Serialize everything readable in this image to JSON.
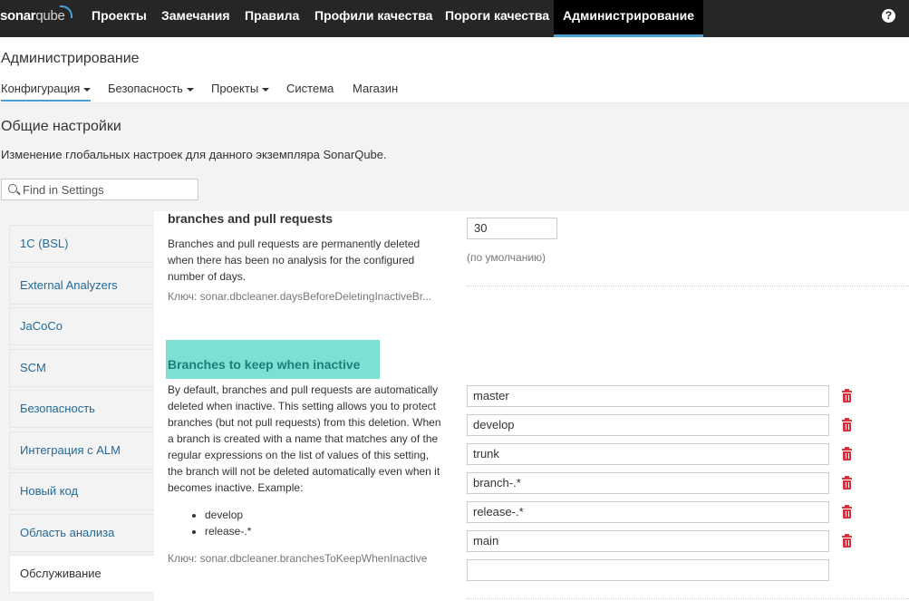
{
  "topnav": {
    "logo_bold": "sonar",
    "logo_light": "qube",
    "links": [
      "Проекты",
      "Замечания",
      "Правила",
      "Профили качества",
      "Пороги качества",
      "Администрирование"
    ],
    "help_glyph": "?"
  },
  "page": {
    "title": "Администрирование",
    "tabs": [
      "Конфигурация",
      "Безопасность",
      "Проекты",
      "Система",
      "Магазин"
    ]
  },
  "settings": {
    "title": "Общие настройки",
    "description": "Изменение глобальных настроек для данного экземпляра SonarQube.",
    "search_placeholder": "Find in Settings"
  },
  "sidebar": {
    "items": [
      "1C (BSL)",
      "External Analyzers",
      "JaCoCo",
      "SCM",
      "Безопасность",
      "Интеграция с ALM",
      "Новый код",
      "Область анализа",
      "Обслуживание"
    ],
    "active_index": 8
  },
  "props": {
    "branches_delete": {
      "title": "branches and pull requests",
      "desc": "Branches and pull requests are permanently deleted when there has been no analysis for the configured number of days.",
      "key": "Ключ: sonar.dbcleaner.daysBeforeDeletingInactiveBr...",
      "value": "30",
      "hint": "(по умолчанию)"
    },
    "branches_keep": {
      "title": "Branches to keep when inactive",
      "desc": "By default, branches and pull requests are automatically deleted when inactive. This setting allows you to protect branches (but not pull requests) from this deletion. When a branch is created with a name that matches any of the regular expressions on the list of values of this setting, the branch will not be deleted automatically even when it becomes inactive. Example:",
      "examples": [
        "develop",
        "release-.*"
      ],
      "key": "Ключ: sonar.dbcleaner.branchesToKeepWhenInactive",
      "values": [
        "master",
        "develop",
        "trunk",
        "branch-.*",
        "release-.*",
        "main",
        ""
      ]
    }
  },
  "colors": {
    "nav_bg": "#262626",
    "accent": "#4b9fd5",
    "highlight": "#7ee0d2",
    "delete": "#d4333f",
    "link": "#236a97"
  }
}
